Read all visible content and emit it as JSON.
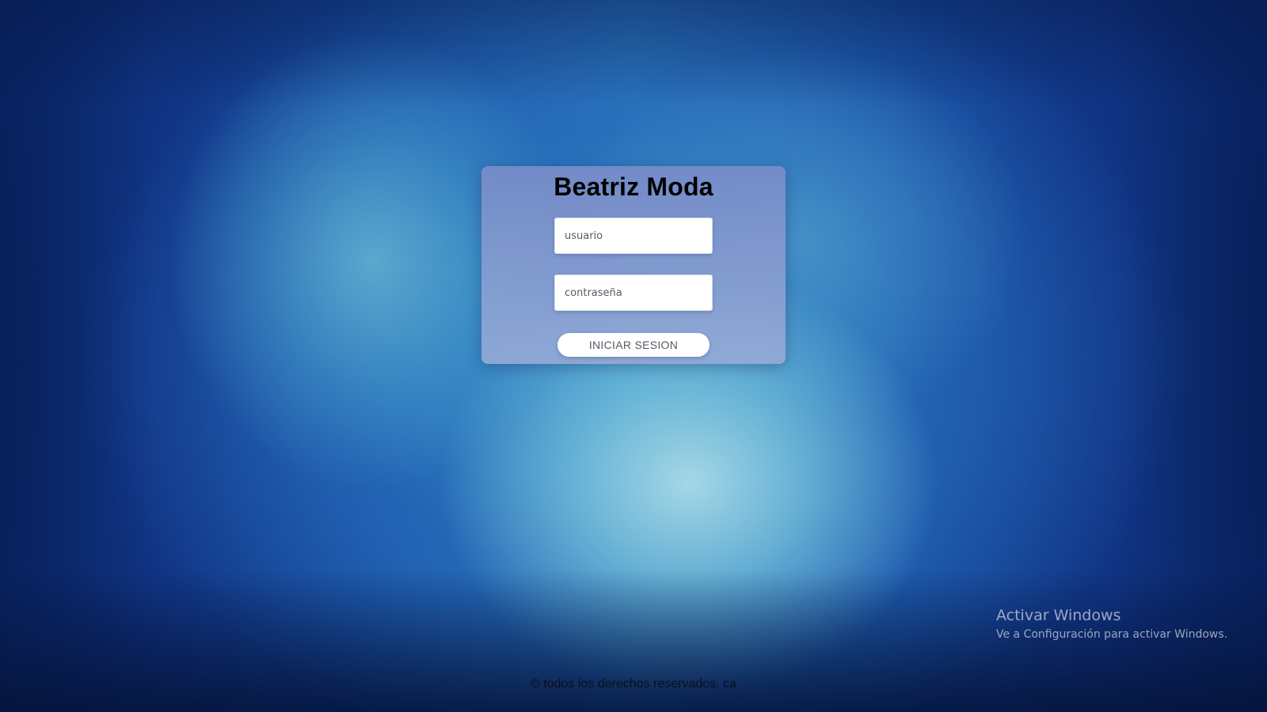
{
  "login": {
    "brand_title": "Beatriz Moda",
    "username_placeholder": "usuario",
    "password_placeholder": "contraseña",
    "submit_label": "INICIAR SESION"
  },
  "footer": {
    "copyright": "© todos los derechos reservados. ca"
  },
  "windows_activation": {
    "title": "Activar Windows",
    "subtitle": "Ve a Configuración para activar Windows."
  },
  "colors": {
    "card_background": "#8a9ed2",
    "button_text": "#555b66",
    "background_primary": "#1a4fa0",
    "background_highlight": "#9fd4e4"
  }
}
